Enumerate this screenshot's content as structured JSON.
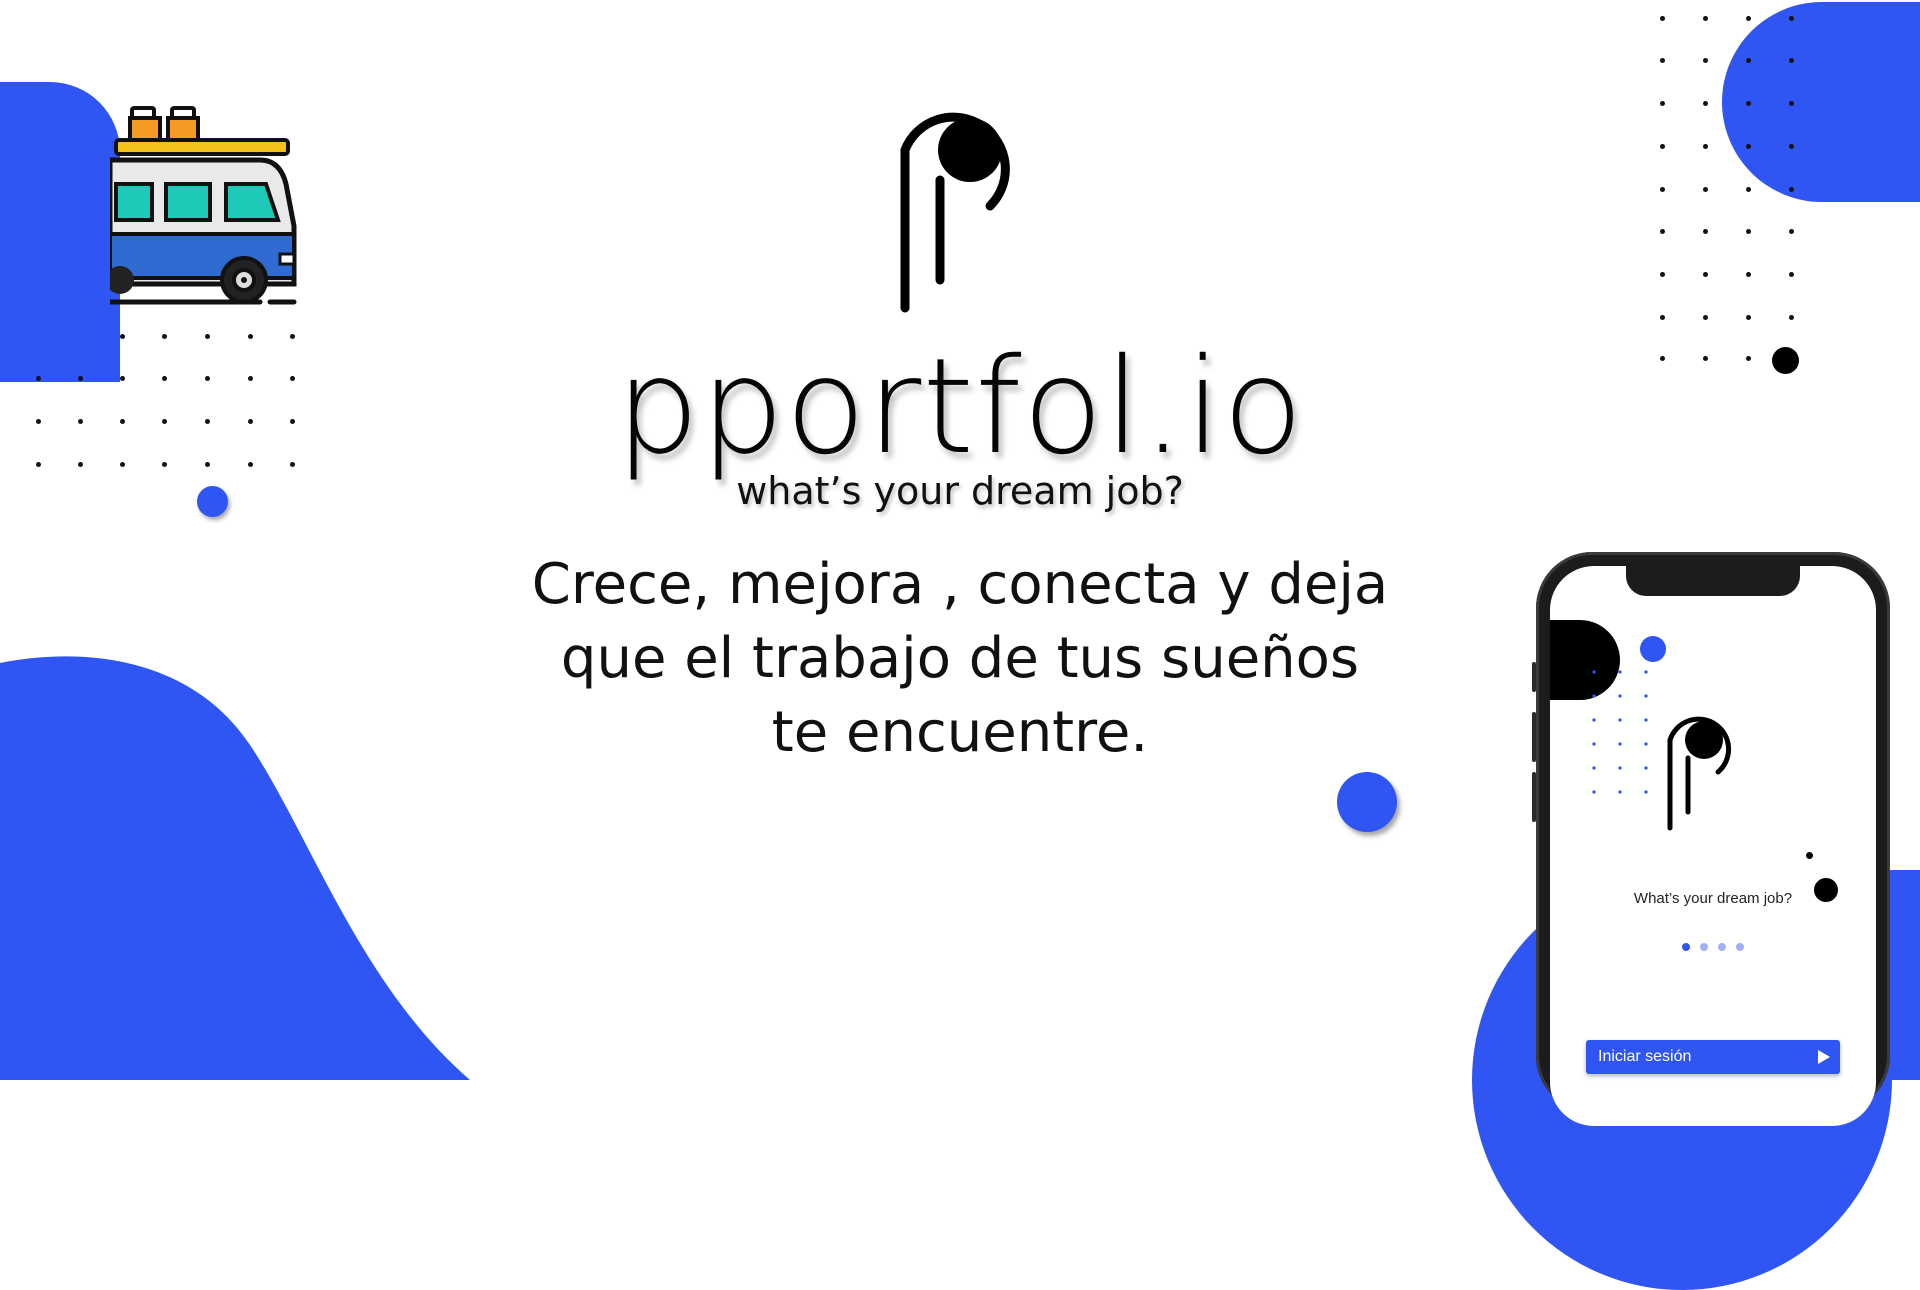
{
  "brand": {
    "name": "pportfol.io",
    "tagline": "what’s your dream job?"
  },
  "headline": {
    "lines": [
      "Crece, mejora ,  conecta y deja",
      "que el trabajo de tus sueños",
      "te encuentre."
    ]
  },
  "phone": {
    "tagline": "What’s your dream job?",
    "pager": {
      "count": 4,
      "active": 1
    },
    "login_label": "Iniciar sesión"
  },
  "icons": {
    "logo": "p-logo-icon",
    "van": "van-icon",
    "play": "play-icon"
  },
  "colors": {
    "accent": "#2f55f2",
    "text": "#111111",
    "background": "#ffffff"
  }
}
